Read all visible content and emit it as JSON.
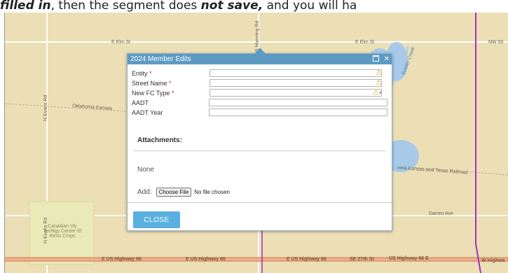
{
  "caption": {
    "part1": "filled in",
    "part2": ", then the segment does ",
    "part3": "not save,",
    "part4": " and you will ha"
  },
  "map": {
    "labels": {
      "e_elm_st_left": "E Elm St",
      "e_elm_st_right": "E Elm St",
      "nw_50": "NW 50",
      "n_evans_rd_top": "N Evans Rd",
      "n_evans_rd_bottom": "N Evans Rd",
      "oklahoma_kansas": "Oklahoma Kansas",
      "oklahoma_kansas_rail": "oma Kansas and Texas Railroad",
      "darren_ave": "Darren Ave",
      "canadian_vly": "Canadian Vly Techlgy Center-El Reno Cmps",
      "us66_1": "E US Highway 66",
      "us66_2": "E US Highway 66",
      "us66_3": "E US Highway 66",
      "se_27th": "SE 27th St",
      "us66_4": "US Highway 66 E",
      "w_highway": "W Highwa",
      "manning": "S Manning Rd",
      "creek": "Soldier Creek"
    },
    "colors": {
      "land": "#ecdfb6",
      "water": "#a8c9e8",
      "highway": "#e3a27a",
      "boundary": "#a030c0"
    }
  },
  "dialog": {
    "title": "2024 Member Edits",
    "fields": [
      {
        "label": "Entity",
        "required": true,
        "value": "",
        "warning": true
      },
      {
        "label": "Street Name",
        "required": true,
        "value": "",
        "warning": true
      },
      {
        "label": "New FC Type",
        "required": true,
        "value": "",
        "warning": true,
        "dropdown": true
      },
      {
        "label": "AADT",
        "required": false,
        "value": "",
        "warning": false
      },
      {
        "label": "AADT Year",
        "required": false,
        "value": "",
        "warning": false
      }
    ],
    "required_mark": "*",
    "warning_glyph": "⚠",
    "dropdown_glyph": "▾",
    "attachments_title": "Attachments:",
    "none_text": "None",
    "add_label": "Add:",
    "file_button": "Choose File",
    "file_status": "No file chosen",
    "close_label": "CLOSE",
    "maximize_glyph": "",
    "close_glyph": "✕"
  }
}
